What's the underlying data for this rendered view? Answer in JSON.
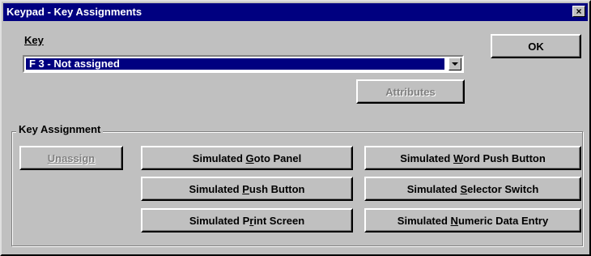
{
  "window": {
    "title": "Keypad - Key Assignments",
    "close_label": "×"
  },
  "key": {
    "label": "Key",
    "selected": "F 3 - Not assigned"
  },
  "ok_button": {
    "label": "OK"
  },
  "attributes_button": {
    "label": "Attributes"
  },
  "assignment": {
    "group_label": "Key Assignment",
    "unassign_label": "Unassign",
    "goto_panel": {
      "pre": "Simulated ",
      "key": "G",
      "post": "oto Panel"
    },
    "push_button": {
      "pre": "Simulated ",
      "key": "P",
      "post": "ush Button"
    },
    "print_screen": {
      "pre": "Simulated P",
      "key": "r",
      "post": "int Screen"
    },
    "word_push_button": {
      "pre": "Simulated ",
      "key": "W",
      "post": "ord Push Button"
    },
    "selector_switch": {
      "pre": "Simulated ",
      "key": "S",
      "post": "elector Switch"
    },
    "numeric_data_entry": {
      "pre": "Simulated ",
      "key": "N",
      "post": "umeric Data Entry"
    }
  },
  "colors": {
    "face": "#c0c0c0",
    "titlebar": "#000080",
    "highlight": "#000080"
  }
}
